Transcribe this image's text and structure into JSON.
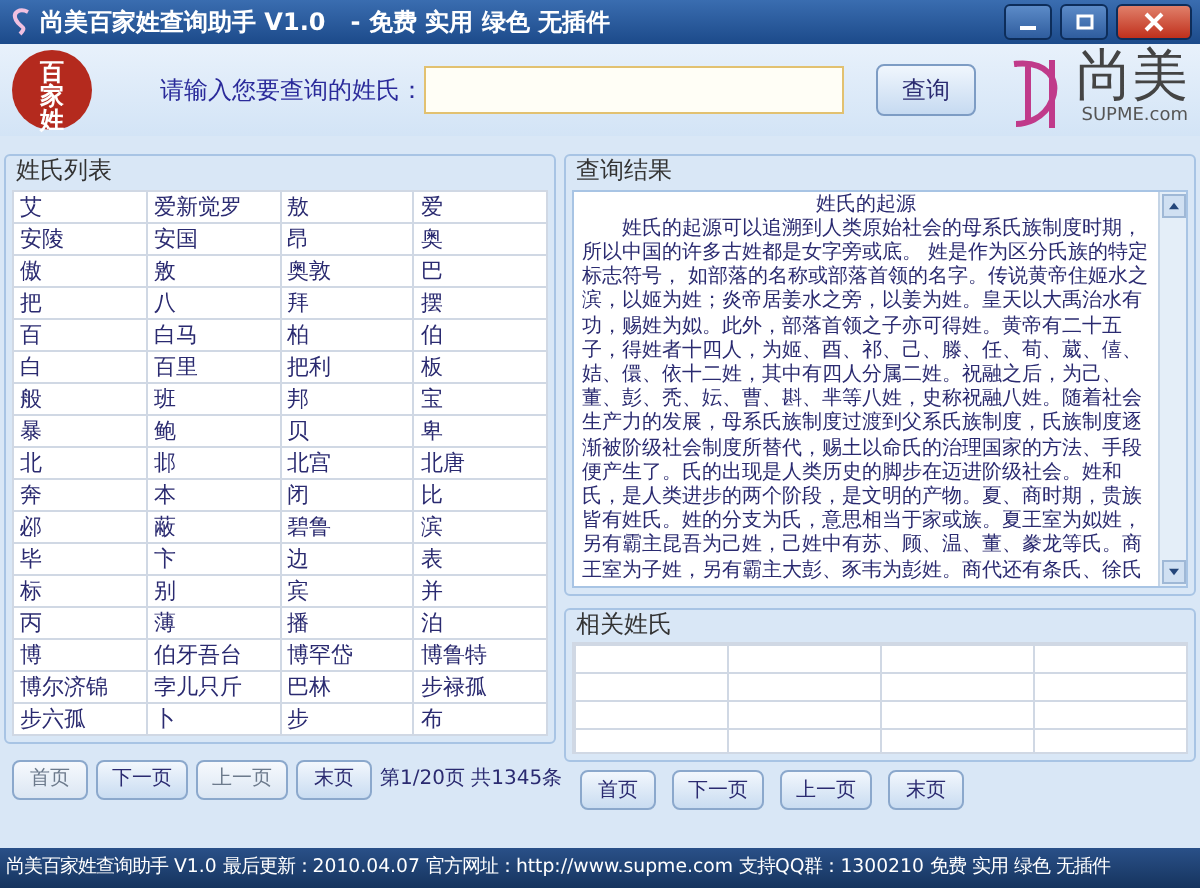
{
  "window": {
    "title": "尚美百家姓查询助手 V1.0   - 免费 实用 绿色 无插件"
  },
  "header": {
    "logo_text": "百家姓",
    "search_label": "请输入您要查询的姓氏：",
    "search_button": "查询",
    "brand_name": "尚美",
    "brand_site": "SUPME.com"
  },
  "surname_list": {
    "title": "姓氏列表",
    "rows": [
      [
        "艾",
        "爱新觉罗",
        "敖",
        "爱"
      ],
      [
        "安陵",
        "安国",
        "昂",
        "奥"
      ],
      [
        "傲",
        "敫",
        "奥敦",
        "巴"
      ],
      [
        "把",
        "八",
        "拜",
        "摆"
      ],
      [
        "百",
        "白马",
        "柏",
        "伯"
      ],
      [
        "白",
        "百里",
        "把利",
        "板"
      ],
      [
        "般",
        "班",
        "邦",
        "宝"
      ],
      [
        "暴",
        "鲍",
        "贝",
        "卑"
      ],
      [
        "北",
        "邶",
        "北宫",
        "北唐"
      ],
      [
        "奔",
        "本",
        "闭",
        "比"
      ],
      [
        "邲",
        "蔽",
        "碧鲁",
        "滨"
      ],
      [
        "毕",
        "卞",
        "边",
        "表"
      ],
      [
        "标",
        "别",
        "宾",
        "并"
      ],
      [
        "丙",
        "薄",
        "播",
        "泊"
      ],
      [
        "博",
        "伯牙吾台",
        "博罕岱",
        "博鲁特"
      ],
      [
        "博尔济锦",
        "孛儿只斤",
        "巴林",
        "步禄孤"
      ],
      [
        "步六孤",
        "卜",
        "步",
        "布"
      ]
    ],
    "pager": {
      "buttons": [
        {
          "label": "首页",
          "disabled": true
        },
        {
          "label": "下一页",
          "disabled": false
        },
        {
          "label": "上一页",
          "disabled": true
        },
        {
          "label": "末页",
          "disabled": false
        }
      ],
      "info": "第1/20页 共1345条"
    }
  },
  "result": {
    "title": "查询结果",
    "heading": "姓氏的起源",
    "text": "　　姓氏的起源可以追溯到人类原始社会的母系氏族制度时期，所以中国的许多古姓都是女字旁或底。 姓是作为区分氏族的特定标志符号， 如部落的名称或部落首领的名字。传说黄帝住姬水之滨，以姬为姓；炎帝居姜水之旁，以姜为姓。皇天以大禹治水有功，赐姓为姒。此外，部落首领之子亦可得姓。黄帝有二十五子，得姓者十四人，为姬、酉、祁、己、滕、任、荀、葳、僖、姞、儇、依十二姓，其中有四人分属二姓。祝融之后，为己、董、彭、秃、妘、曹、斟、芈等八姓，史称祝融八姓。随着社会生产力的发展，母系氏族制度过渡到父系氏族制度，氏族制度逐渐被阶级社会制度所替代，赐土以命氏的治理国家的方法、手段便产生了。氏的出现是人类历史的脚步在迈进阶级社会。姓和氏，是人类进步的两个阶段，是文明的产物。夏、商时期，贵族皆有姓氏。姓的分支为氏，意思相当于家或族。夏王室为姒姓，另有霸主昆吾为己姓，己姓中有苏、顾、温、董、豢龙等氏。商王室为子姓，另有霸主大彭、豕韦为彭姓。商代还有条氏、徐氏"
  },
  "related": {
    "title": "相关姓氏",
    "pager": {
      "buttons": [
        {
          "label": "首页",
          "disabled": false
        },
        {
          "label": "下一页",
          "disabled": false
        },
        {
          "label": "上一页",
          "disabled": false
        },
        {
          "label": "末页",
          "disabled": false
        }
      ]
    }
  },
  "status_bar": "尚美百家姓查询助手 V1.0 最后更新：2010.04.07 官方网址：http://www.supme.com 支持QQ群：1300210 免费 实用 绿色 无插件"
}
